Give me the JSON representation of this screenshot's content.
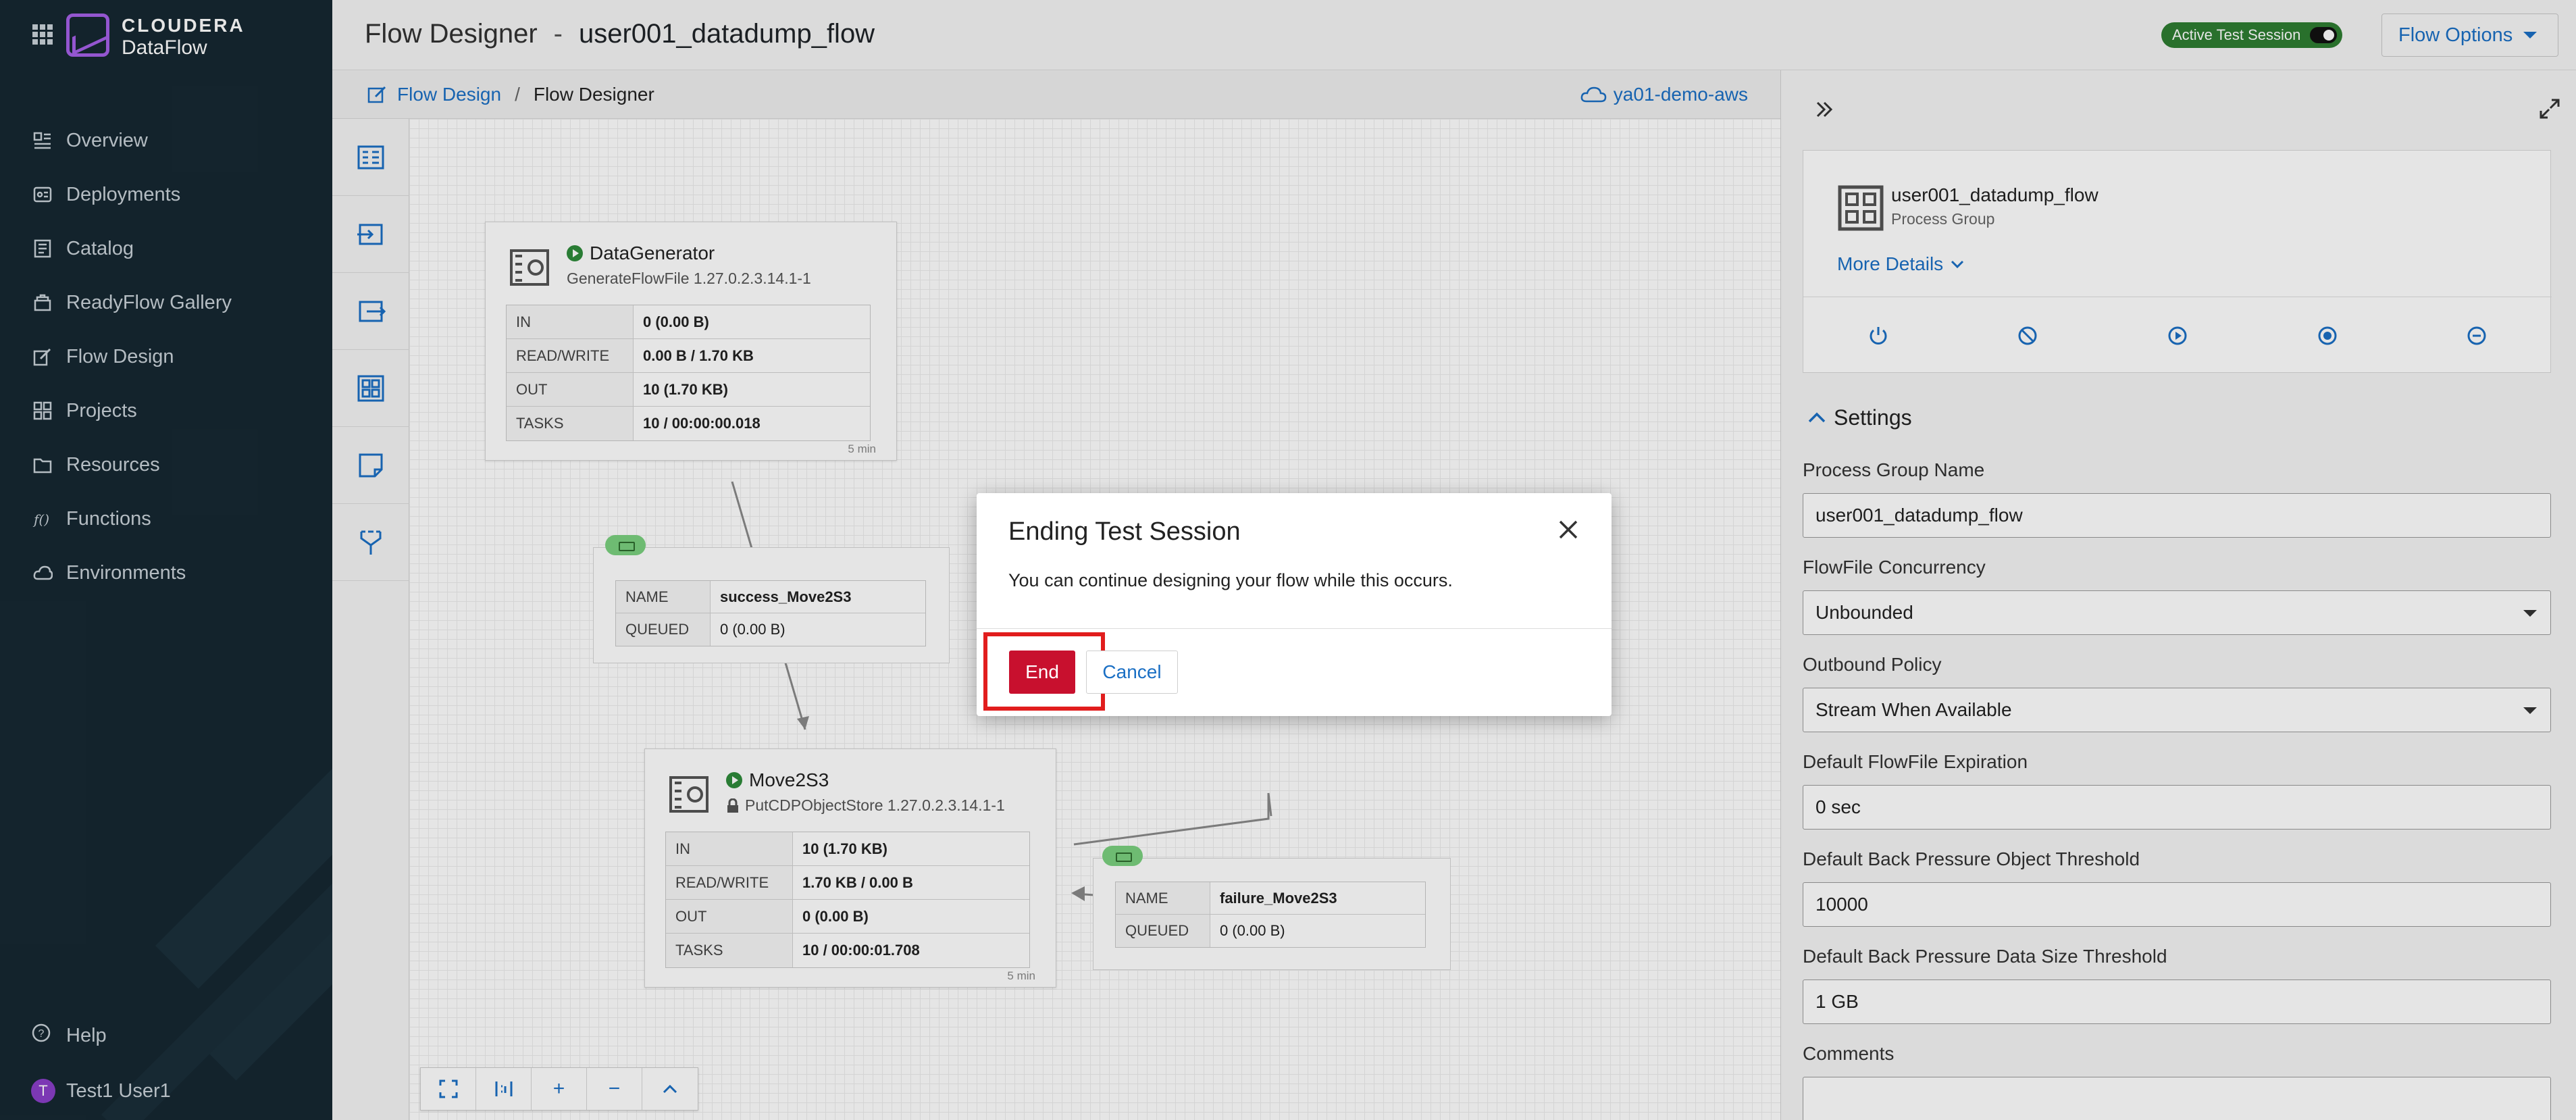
{
  "brand": {
    "line1": "CLOUDERA",
    "line2": "DataFlow"
  },
  "nav": [
    {
      "label": "Overview",
      "icon": "overview-icon"
    },
    {
      "label": "Deployments",
      "icon": "deployments-icon"
    },
    {
      "label": "Catalog",
      "icon": "catalog-icon"
    },
    {
      "label": "ReadyFlow Gallery",
      "icon": "gallery-icon"
    },
    {
      "label": "Flow Design",
      "icon": "flow-design-icon"
    },
    {
      "label": "Projects",
      "icon": "projects-icon"
    },
    {
      "label": "Resources",
      "icon": "resources-icon"
    },
    {
      "label": "Functions",
      "icon": "functions-icon"
    },
    {
      "label": "Environments",
      "icon": "environments-icon"
    }
  ],
  "sidebar_footer": {
    "help": "Help",
    "user": "Test1 User1",
    "avatar_initial": "T"
  },
  "header": {
    "title": "Flow Designer",
    "separator": "-",
    "flow_name": "user001_datadump_flow",
    "session_badge": "Active Test Session",
    "flow_options": "Flow Options"
  },
  "breadcrumb": {
    "root": "Flow Design",
    "separator": "/",
    "current": "Flow Designer",
    "environment": "ya01-demo-aws"
  },
  "processors": [
    {
      "name": "DataGenerator",
      "type": "GenerateFlowFile 1.27.0.2.3.14.1-1",
      "stats": [
        {
          "k": "IN",
          "v": "0 (0.00 B)"
        },
        {
          "k": "READ/WRITE",
          "v": "0.00 B / 1.70 KB"
        },
        {
          "k": "OUT",
          "v": "10 (1.70 KB)"
        },
        {
          "k": "TASKS",
          "v": "10 / 00:00:00.018"
        }
      ],
      "window": "5 min"
    },
    {
      "name": "Move2S3",
      "type": "PutCDPObjectStore 1.27.0.2.3.14.1-1",
      "stats": [
        {
          "k": "IN",
          "v": "10 (1.70 KB)"
        },
        {
          "k": "READ/WRITE",
          "v": "1.70 KB / 0.00 B"
        },
        {
          "k": "OUT",
          "v": "0 (0.00 B)"
        },
        {
          "k": "TASKS",
          "v": "10 / 00:00:01.708"
        }
      ],
      "window": "5 min"
    }
  ],
  "connections": [
    {
      "name_label": "NAME",
      "name": "success_Move2S3",
      "queued_label": "QUEUED",
      "queued": "0 (0.00 B)"
    },
    {
      "name_label": "NAME",
      "name": "failure_Move2S3",
      "queued_label": "QUEUED",
      "queued": "0 (0.00 B)"
    }
  ],
  "canvas_controls": [
    "fit",
    "actual-size",
    "+",
    "−",
    "^"
  ],
  "panel": {
    "pg_name": "user001_datadump_flow",
    "pg_type": "Process Group",
    "more_details": "More Details",
    "settings_title": "Settings",
    "fields": [
      {
        "label": "Process Group Name",
        "value": "user001_datadump_flow",
        "dropdown": false
      },
      {
        "label": "FlowFile Concurrency",
        "value": "Unbounded",
        "dropdown": true
      },
      {
        "label": "Outbound Policy",
        "value": "Stream When Available",
        "dropdown": true
      },
      {
        "label": "Default FlowFile Expiration",
        "value": "0 sec",
        "dropdown": false
      },
      {
        "label": "Default Back Pressure Object Threshold",
        "value": "10000",
        "dropdown": false
      },
      {
        "label": "Default Back Pressure Data Size Threshold",
        "value": "1 GB",
        "dropdown": false
      },
      {
        "label": "Comments",
        "value": "",
        "dropdown": false
      }
    ]
  },
  "modal": {
    "title": "Ending Test Session",
    "message": "You can continue designing your flow while this occurs.",
    "end_label": "End",
    "cancel_label": "Cancel"
  },
  "colors": {
    "sidebar": "#162832",
    "accent": "#1a6fc4",
    "danger": "#c8102e",
    "session": "#2e7d32",
    "brand": "#a560e8"
  }
}
